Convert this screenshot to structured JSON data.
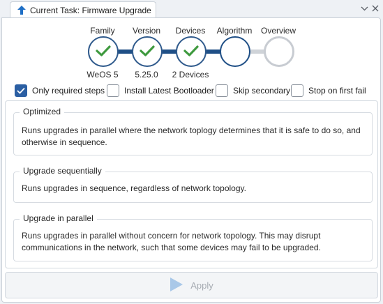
{
  "tab": {
    "title": "Current Task: Firmware Upgrade",
    "icon": "up-arrow-icon"
  },
  "window_controls": [
    {
      "name": "chevron-down-icon",
      "glyph": "⌄"
    },
    {
      "name": "close-icon",
      "glyph": "✕"
    }
  ],
  "steps": [
    {
      "label": "Family",
      "value": "WeOS 5",
      "state": "done"
    },
    {
      "label": "Version",
      "value": "5.25.0",
      "state": "done"
    },
    {
      "label": "Devices",
      "value": "2 Devices",
      "state": "done"
    },
    {
      "label": "Algorithm",
      "value": "",
      "state": "current"
    },
    {
      "label": "Overview",
      "value": "",
      "state": "pending"
    }
  ],
  "checkboxes": [
    {
      "label": "Only required steps",
      "checked": true
    },
    {
      "label": "Install Latest Bootloader",
      "checked": false
    },
    {
      "label": "Skip secondary",
      "checked": false
    },
    {
      "label": "Stop on first fail",
      "checked": false
    }
  ],
  "options": [
    {
      "title": "Optimized",
      "description": "Runs upgrades in parallel where the network toplogy determines that it is safe to do so, and otherwise in sequence."
    },
    {
      "title": "Upgrade sequentially",
      "description": "Runs upgrades in sequence, regardless of network topology."
    },
    {
      "title": "Upgrade in parallel",
      "description": "Runs upgrades in parallel without concern for network topology. This may disrupt communications in the network, such that some devices may fail to be upgraded."
    }
  ],
  "apply": {
    "label": "Apply",
    "icon": "play-icon",
    "enabled": false
  },
  "colors": {
    "accent": "#2b5fa3",
    "step_done_check": "#3f9a3f",
    "step_ring": "#2f5a8c",
    "connector_done": "#1f4f86",
    "connector_pending": "#cfd3d8",
    "apply_icon_disabled": "#a9c8e8"
  }
}
